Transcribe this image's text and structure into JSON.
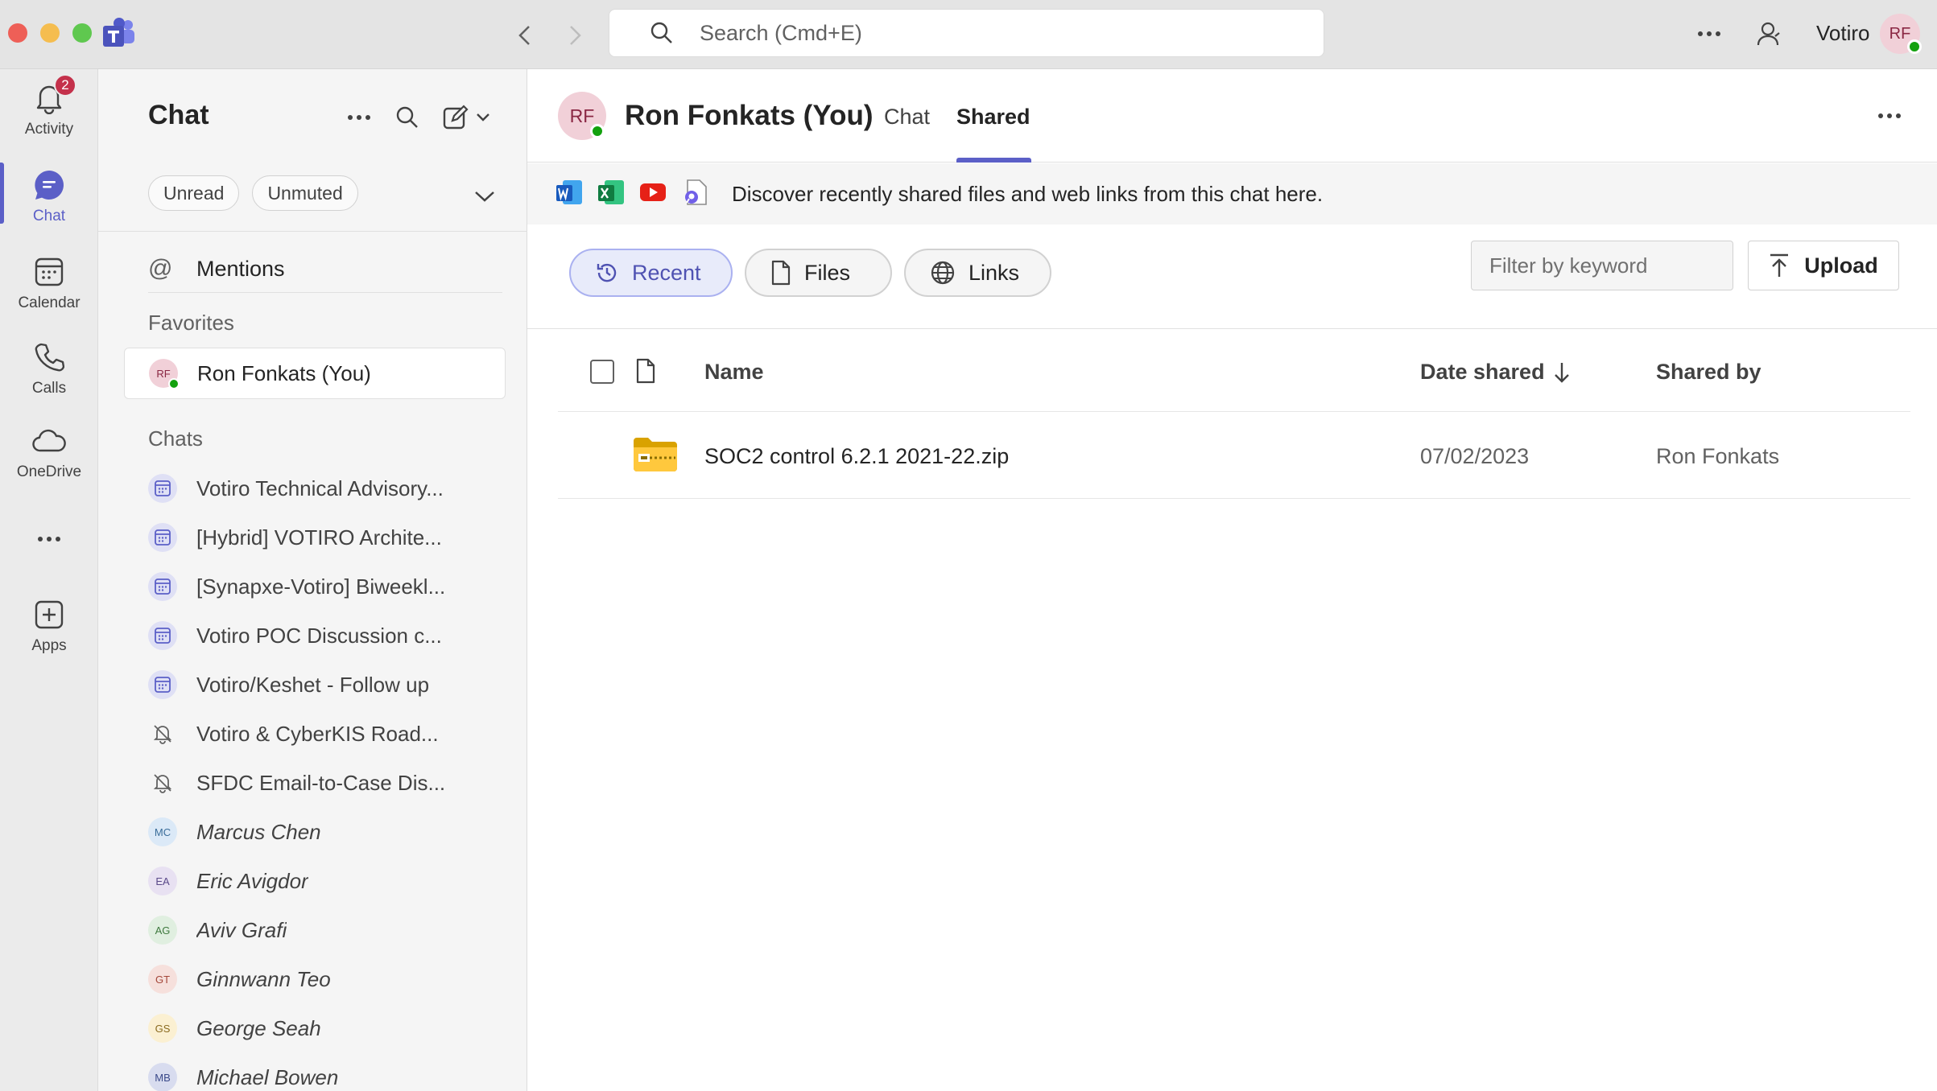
{
  "titlebar": {
    "search_placeholder": "Search (Cmd+E)",
    "org_name": "Votiro",
    "user_initials": "RF"
  },
  "rail": {
    "items": [
      {
        "label": "Activity",
        "badge": "2"
      },
      {
        "label": "Chat"
      },
      {
        "label": "Calendar"
      },
      {
        "label": "Calls"
      },
      {
        "label": "OneDrive"
      },
      {
        "label": "Apps"
      }
    ]
  },
  "chatlist": {
    "title": "Chat",
    "filters": [
      "Unread",
      "Unmuted"
    ],
    "mentions_label": "Mentions",
    "favorites_label": "Favorites",
    "favorites": [
      {
        "initials": "RF",
        "name": "Ron Fonkats (You)"
      }
    ],
    "chats_label": "Chats",
    "chats": [
      {
        "name": "Votiro Technical Advisory...",
        "kind": "meeting"
      },
      {
        "name": "[Hybrid] VOTIRO Archite...",
        "kind": "meeting"
      },
      {
        "name": "[Synapxe-Votiro] Biweekl...",
        "kind": "meeting"
      },
      {
        "name": "Votiro POC Discussion c...",
        "kind": "meeting"
      },
      {
        "name": "Votiro/Keshet - Follow up",
        "kind": "meeting"
      },
      {
        "name": "Votiro & CyberKIS Road...",
        "kind": "muted"
      },
      {
        "name": "SFDC Email-to-Case Dis...",
        "kind": "muted"
      },
      {
        "name": "Marcus Chen",
        "initials": "MC",
        "kind": "person",
        "color": "#dbe9f7",
        "text_color": "#3a6d9a"
      },
      {
        "name": "Eric Avigdor",
        "initials": "EA",
        "kind": "person",
        "color": "#e8e1f2",
        "text_color": "#5b4a8a"
      },
      {
        "name": "Aviv Grafi",
        "initials": "AG",
        "kind": "person",
        "color": "#e0efe0",
        "text_color": "#3f7a3f"
      },
      {
        "name": "Ginnwann Teo",
        "initials": "GT",
        "kind": "person",
        "color": "#f6e0dc",
        "text_color": "#a4473a"
      },
      {
        "name": "George Seah",
        "initials": "GS",
        "kind": "person",
        "color": "#fbf0d2",
        "text_color": "#8a6a1f"
      },
      {
        "name": "Michael Bowen",
        "initials": "MB",
        "kind": "person",
        "color": "#d8dcef",
        "text_color": "#3b4a8a"
      }
    ]
  },
  "main": {
    "header": {
      "initials": "RF",
      "name": "Ron Fonkats (You)",
      "tabs": [
        {
          "label": "Chat"
        },
        {
          "label": "Shared",
          "active": true
        }
      ]
    },
    "banner_text": "Discover recently shared files and web links from this chat here.",
    "pills": [
      {
        "label": "Recent",
        "active": true
      },
      {
        "label": "Files"
      },
      {
        "label": "Links"
      }
    ],
    "filter_placeholder": "Filter by keyword",
    "upload_label": "Upload",
    "table": {
      "columns": [
        "Name",
        "Date shared",
        "Shared by"
      ],
      "rows": [
        {
          "name": "SOC2 control 6.2.1 2021-22.zip",
          "date": "07/02/2023",
          "shared_by": "Ron Fonkats"
        }
      ]
    }
  },
  "colors": {
    "accent": "#5b5fc7",
    "presence": "#13a10e",
    "badge": "#c4314b"
  }
}
